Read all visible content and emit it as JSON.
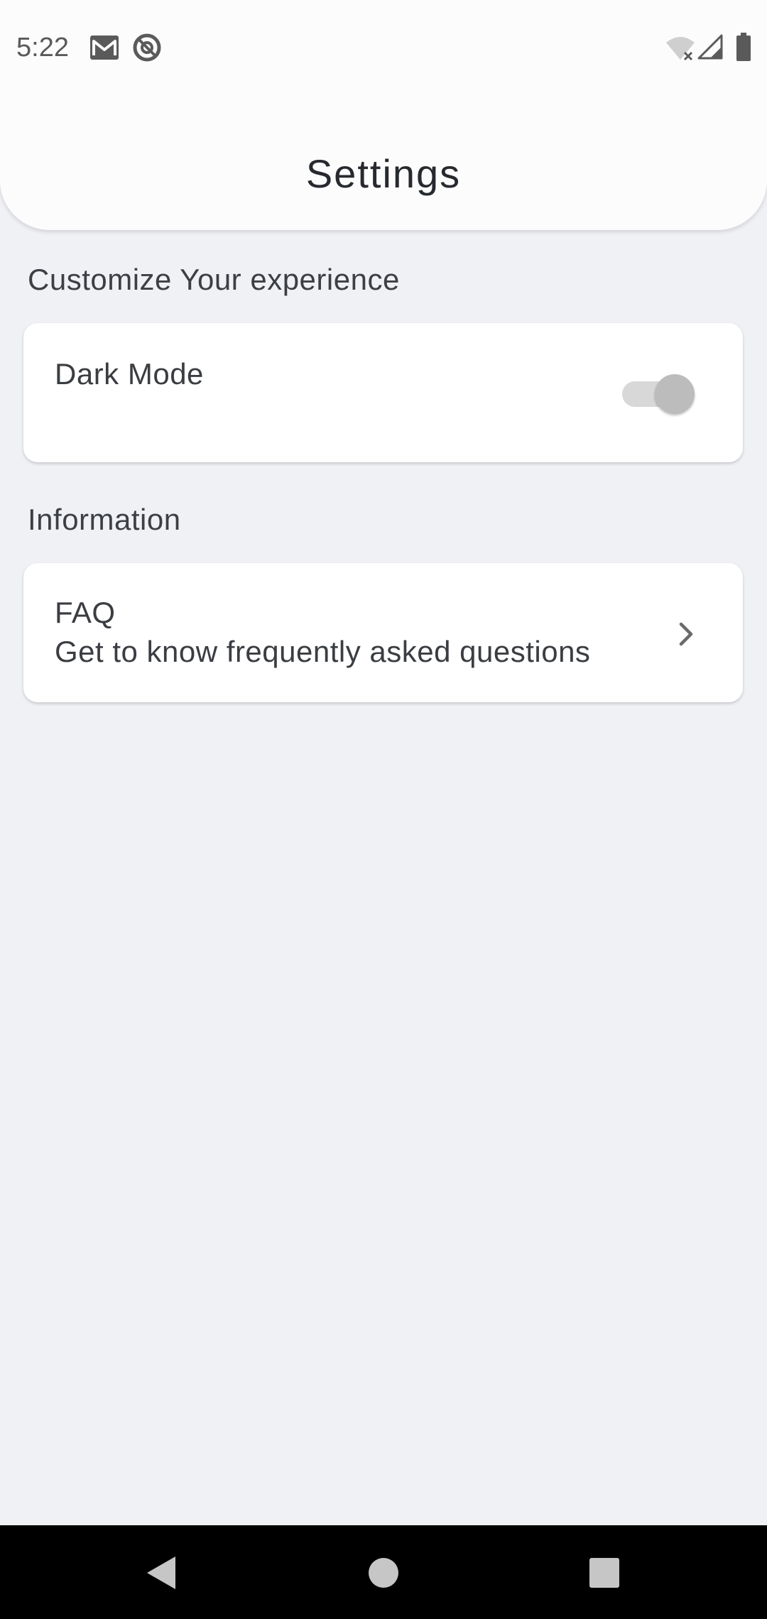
{
  "status_bar": {
    "time": "5:22",
    "left_icons": [
      "gmail-icon",
      "at-sign-icon"
    ],
    "right_icons": [
      "wifi-off-icon",
      "cell-signal-icon",
      "battery-icon"
    ]
  },
  "header": {
    "title": "Settings"
  },
  "sections": {
    "customize": {
      "label": "Customize Your experience",
      "dark_mode": {
        "label": "Dark Mode",
        "enabled": false
      }
    },
    "information": {
      "label": "Information",
      "faq": {
        "title": "FAQ",
        "subtitle": "Get to know frequently asked questions"
      }
    }
  },
  "nav_bar": {
    "buttons": [
      "back-icon",
      "home-icon",
      "recents-icon"
    ]
  },
  "colors": {
    "background": "#f0f1f5",
    "header": "#fcfcfd",
    "card": "#ffffff",
    "text": "#3a3d41"
  }
}
